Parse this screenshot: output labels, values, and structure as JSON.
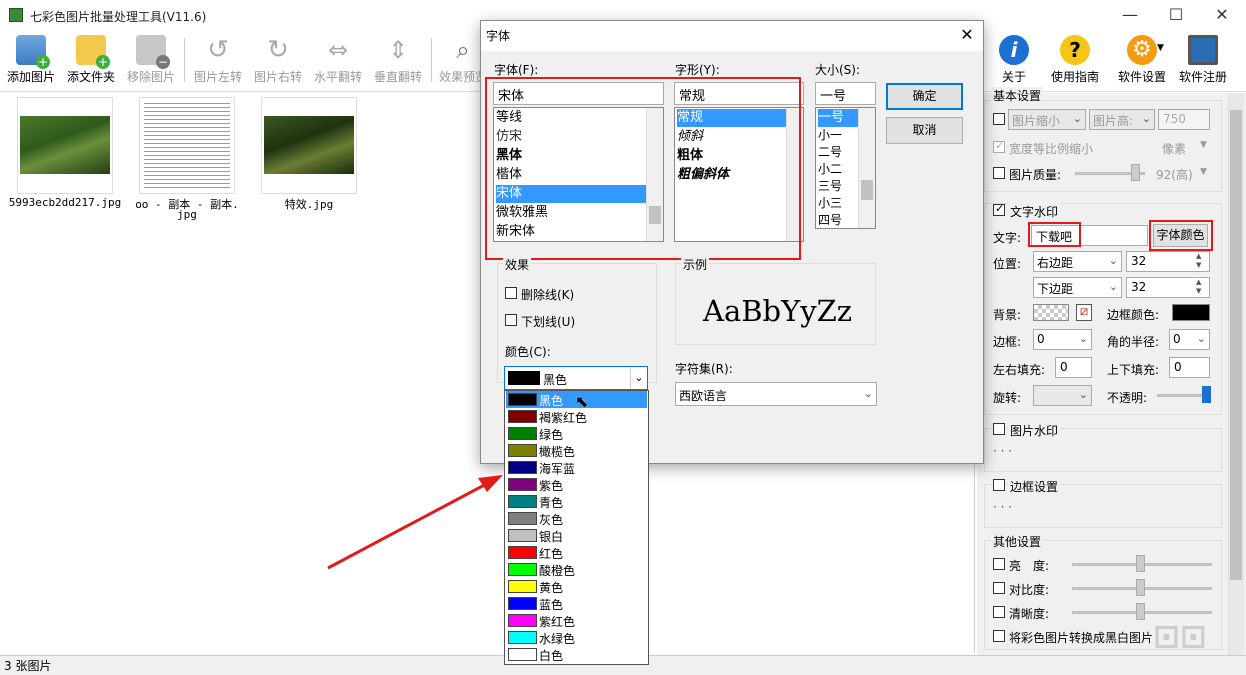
{
  "window": {
    "title": "七彩色图片批量处理工具(V11.6)",
    "minimize": "—",
    "maximize": "☐",
    "close": "✕"
  },
  "toolbar": {
    "add_image": "添加图片",
    "add_folder": "添文件夹",
    "remove_image": "移除图片",
    "rotate_left": "图片左转",
    "rotate_right": "图片右转",
    "flip_h": "水平翻转",
    "flip_v": "垂直翻转",
    "preview": "效果预览",
    "about": "关于",
    "guide": "使用指南",
    "settings": "软件设置",
    "register": "软件注册"
  },
  "thumbnails": [
    {
      "name": "5993ecb2dd217.jpg"
    },
    {
      "name_line1": "oo - 副本 - 副本.",
      "name_line2": "jpg"
    },
    {
      "name": "特效.jpg"
    }
  ],
  "status": {
    "count": "3 张图片"
  },
  "right_panel": {
    "basic_settings": "基本设置",
    "shrink": "图片缩小",
    "height_sel": "图片高:",
    "height_val": "750",
    "keep_ratio": "宽度等比例缩小",
    "pixel": "像素",
    "quality": "图片质量:",
    "quality_val": "92(高)",
    "text_watermark": "文字水印",
    "text_label": "文字:",
    "text_value": "下载吧",
    "font_color_btn": "字体颜色",
    "position_label": "位置:",
    "pos_h": "右边距",
    "pos_h_val": "32",
    "pos_v": "下边距",
    "pos_v_val": "32",
    "bg_label": "背景:",
    "border_color_label": "边框颜色:",
    "border_label": "边框:",
    "border_val": "0",
    "radius_label": "角的半径:",
    "radius_val": "0",
    "lr_pad_label": "左右填充:",
    "lr_pad_val": "0",
    "tb_pad_label": "上下填充:",
    "tb_pad_val": "0",
    "rotate_label": "旋转:",
    "opacity_label": "不透明:",
    "image_watermark": "图片水印",
    "dots": "· · ·",
    "border_settings": "边框设置",
    "other_settings": "其他设置",
    "brightness": "亮　度:",
    "contrast": "对比度:",
    "sharpness": "清晰度:",
    "grayscale": "将彩色图片转换成黑白图片"
  },
  "font_dialog": {
    "title": "字体",
    "font_label": "字体(F):",
    "font_value": "宋体",
    "fonts": [
      "等线",
      "仿宋",
      "黑体",
      "楷体",
      "宋体",
      "微软雅黑",
      "新宋体"
    ],
    "font_selected_index": 4,
    "style_label": "字形(Y):",
    "style_value": "常规",
    "styles": [
      "常规",
      "倾斜",
      "粗体",
      "粗偏斜体"
    ],
    "size_label": "大小(S):",
    "size_value": "一号",
    "sizes": [
      "一号",
      "小一",
      "二号",
      "小二",
      "三号",
      "小三",
      "四号"
    ],
    "ok": "确定",
    "cancel": "取消",
    "effects_label": "效果",
    "strikeout": "删除线(K)",
    "underline": "下划线(U)",
    "color_label": "颜色(C):",
    "color_value": "黑色",
    "sample_label": "示例",
    "sample_text": "AaBbYyZz",
    "charset_label": "字符集(R):",
    "charset_value": "西欧语言"
  },
  "color_options": [
    {
      "name": "黑色",
      "hex": "#000000"
    },
    {
      "name": "褐紫红色",
      "hex": "#800000"
    },
    {
      "name": "绿色",
      "hex": "#008000"
    },
    {
      "name": "橄榄色",
      "hex": "#808000"
    },
    {
      "name": "海军蓝",
      "hex": "#000080"
    },
    {
      "name": "紫色",
      "hex": "#800080"
    },
    {
      "name": "青色",
      "hex": "#008080"
    },
    {
      "name": "灰色",
      "hex": "#808080"
    },
    {
      "name": "银白",
      "hex": "#c0c0c0"
    },
    {
      "name": "红色",
      "hex": "#ff0000"
    },
    {
      "name": "酸橙色",
      "hex": "#00ff00"
    },
    {
      "name": "黄色",
      "hex": "#ffff00"
    },
    {
      "name": "蓝色",
      "hex": "#0000ff"
    },
    {
      "name": "紫红色",
      "hex": "#ff00ff"
    },
    {
      "name": "水绿色",
      "hex": "#00ffff"
    },
    {
      "name": "白色",
      "hex": "#ffffff"
    }
  ],
  "colors": {
    "highlight": "#3399ff",
    "annotation_red": "#e21a1a"
  }
}
